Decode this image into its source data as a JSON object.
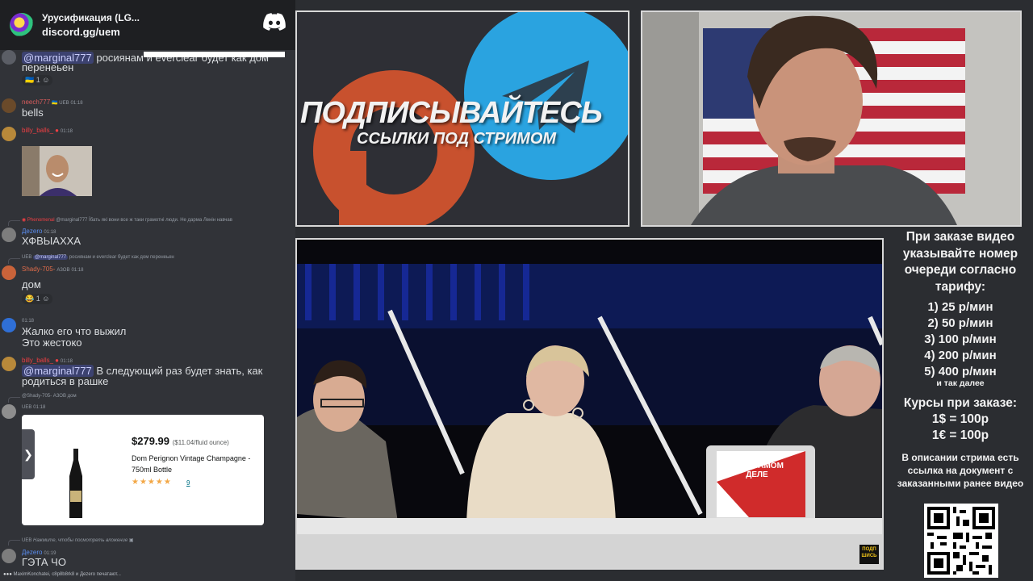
{
  "server": {
    "name": "Урусификация (LG...",
    "invite": "discord.gg/uem"
  },
  "chat": {
    "msg1": {
      "mention": "@marginal777",
      "text": " росиянам и everclear будет как дом",
      "text2": "перенеьен",
      "reaction_count": "1"
    },
    "msg2": {
      "author": "neech777",
      "badge": "UEB",
      "time": "01:18",
      "text": "bells"
    },
    "msg3": {
      "author": "billy_balls_",
      "time": "01:18"
    },
    "msg4": {
      "reply": "@marginal777 Їбать які вони все ж таки грамотні люди. Не дарма Ленін навчав",
      "author": "Дezero",
      "time": "01:18",
      "text": "ХФВЫАХХА"
    },
    "msg5": {
      "reply_badge": "UEB",
      "reply_mention": "@marginal777",
      "reply_text": " росиянам и everclear будет как дом перенеьен",
      "author": "Shady-705-",
      "badge": "АЗОВ",
      "time": "01:18",
      "text": "дом",
      "reaction_count": "1"
    },
    "msg6": {
      "time": "01:18",
      "text": "Жалко его что выжил",
      "text2": "Это жестоко"
    },
    "msg7": {
      "author": "billy_balls_",
      "time": "01:18",
      "mention": "@marginal777",
      "text": " В следующий раз будет знать, как",
      "text2": "родиться в рашке"
    },
    "msg8": {
      "reply": "@Shady-705-",
      "reply_badge": "АЗОВ",
      "reply_text": "дом",
      "badge": "UEB",
      "time": "01:18"
    },
    "embed": {
      "price": "$279.99",
      "per_unit": "($11.04/fluid ounce)",
      "title": "Dom Perignon Vintage Champagne - 750ml Bottle",
      "stars": "★★★★★",
      "rating_count": "9"
    },
    "msg9": {
      "reply_badge": "UEB",
      "reply_text": "Нажмите, чтобы посмотреть вложение",
      "author": "Дezero",
      "time": "01:19",
      "text": "ГЭТА ЧО"
    },
    "typing": "MaximKonchatei, c8p8b8rk8 и Дezero печатают..."
  },
  "promo": {
    "headline": "ПОДПИСЫВАЙТЕСЬ",
    "subheadline": "ССЫЛКИ ПОД СТРИМОМ"
  },
  "main_video": {
    "laptop_text": "А НА САМОМ ДЕЛЕ",
    "logo_text": "ПОДП ШИСЬ"
  },
  "info": {
    "order_note": "При заказе видео указывайте номер очереди согласно тарифу:",
    "tariffs": [
      "1) 25 р/мин",
      "2) 50 р/мин",
      "3) 100 р/мин",
      "4) 200 р/мин",
      "5) 400 р/мин"
    ],
    "etc": "и так далее",
    "rates_title": "Курсы при заказе:",
    "rate_usd": "1$ = 100р",
    "rate_eur": "1€ = 100р",
    "description_note": "В описании стрима есть ссылка на документ с заказанными ранее видео"
  },
  "colors": {
    "accent": "#5865f2",
    "name_red": "#f23f43",
    "telegram_blue": "#2aa3e0",
    "patreon_orange": "#c8512e"
  }
}
